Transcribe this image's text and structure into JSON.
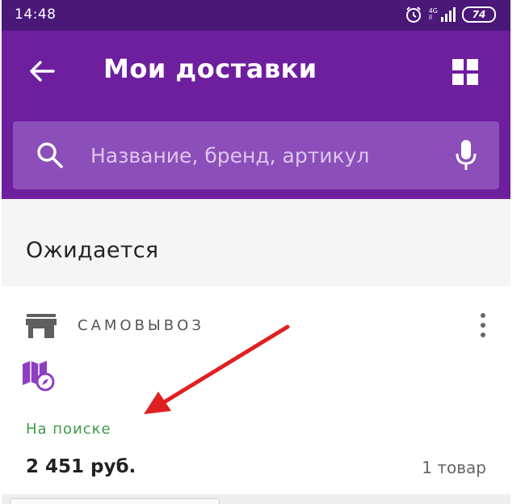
{
  "status_bar": {
    "time": "14:48",
    "network_top": "4G",
    "network_bottom": "il",
    "battery": "74"
  },
  "app_bar": {
    "title": "Мои доставки"
  },
  "search": {
    "placeholder": "Название, бренд, артикул"
  },
  "section": {
    "heading": "Ожидается"
  },
  "delivery": {
    "type": "САМОВЫВОЗ",
    "status": "На поиске",
    "price": "2 451 руб.",
    "item_count": "1 товар"
  },
  "colors": {
    "status_bar": "#4a1877",
    "app_bar": "#6e1f9e",
    "search_box": "#8c4fb9",
    "status_green": "#3c9c46",
    "accent_purple": "#8e3fc1",
    "annotation_red": "#e02020"
  },
  "icons": {
    "back": "arrow-left-icon",
    "grid": "grid-icon",
    "search": "search-icon",
    "mic": "mic-icon",
    "store": "store-icon",
    "more": "more-vertical-icon",
    "map": "map-compass-icon",
    "alarm": "alarm-icon",
    "signal": "signal-icon",
    "battery": "battery-icon"
  }
}
